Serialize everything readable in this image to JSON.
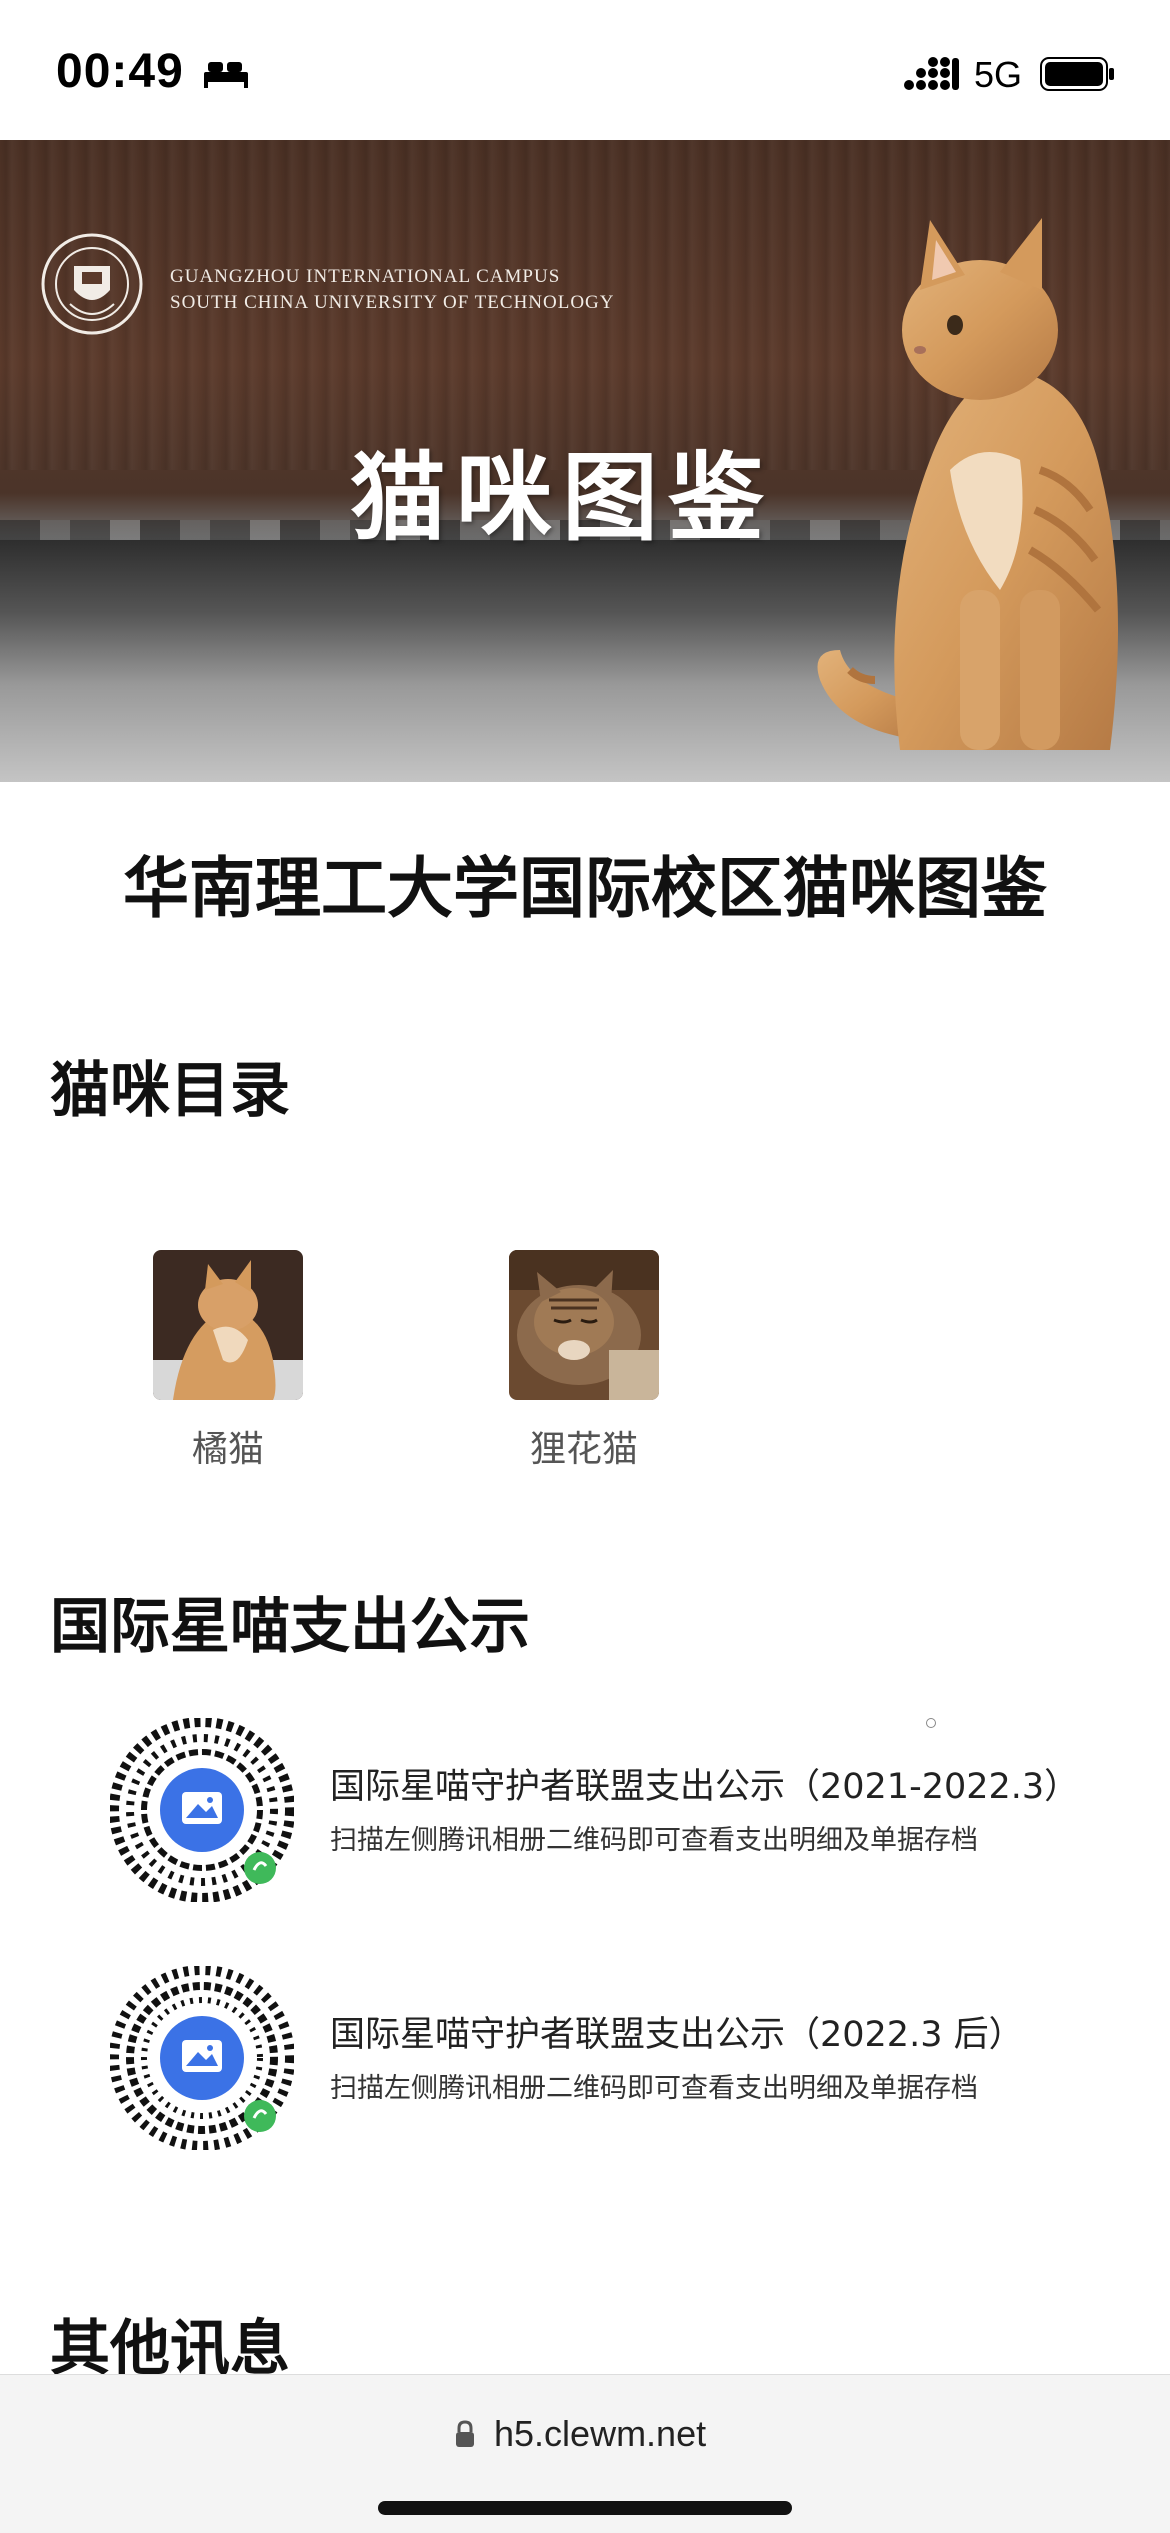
{
  "status_bar": {
    "time": "00:49",
    "network": "5G",
    "sleep_icon": "bed-icon",
    "signal_icon": "signal-icon",
    "battery_icon": "battery-icon"
  },
  "banner": {
    "campus_line1": "GUANGZHOU INTERNATIONAL CAMPUS",
    "campus_line2": "SOUTH CHINA UNIVERSITY OF TECHNOLOGY",
    "title": "猫咪图鉴",
    "seal_icon": "university-seal-logo",
    "photo": "orange-cat-photo"
  },
  "page_title": "华南理工大学国际校区猫咪图鉴",
  "catalog": {
    "heading": "猫咪目录",
    "items": [
      {
        "label": "橘猫",
        "thumb_icon": "orange-cat-thumbnail"
      },
      {
        "label": "狸花猫",
        "thumb_icon": "tabby-cat-thumbnail"
      }
    ]
  },
  "expenses": {
    "heading": "国际星喵支出公示",
    "items": [
      {
        "title": "国际星喵守护者联盟支出公示（2021-2022.3）",
        "subtitle": "扫描左侧腾讯相册二维码即可查看支出明细及单据存档",
        "qr_icon": "mini-program-qr-code"
      },
      {
        "title": "国际星喵守护者联盟支出公示（2022.3 后）",
        "subtitle": "扫描左侧腾讯相册二维码即可查看支出明细及单据存档",
        "qr_icon": "mini-program-qr-code"
      }
    ]
  },
  "other": {
    "heading": "其他讯息"
  },
  "browser": {
    "url": "h5.clewm.net",
    "lock_icon": "lock-icon"
  }
}
